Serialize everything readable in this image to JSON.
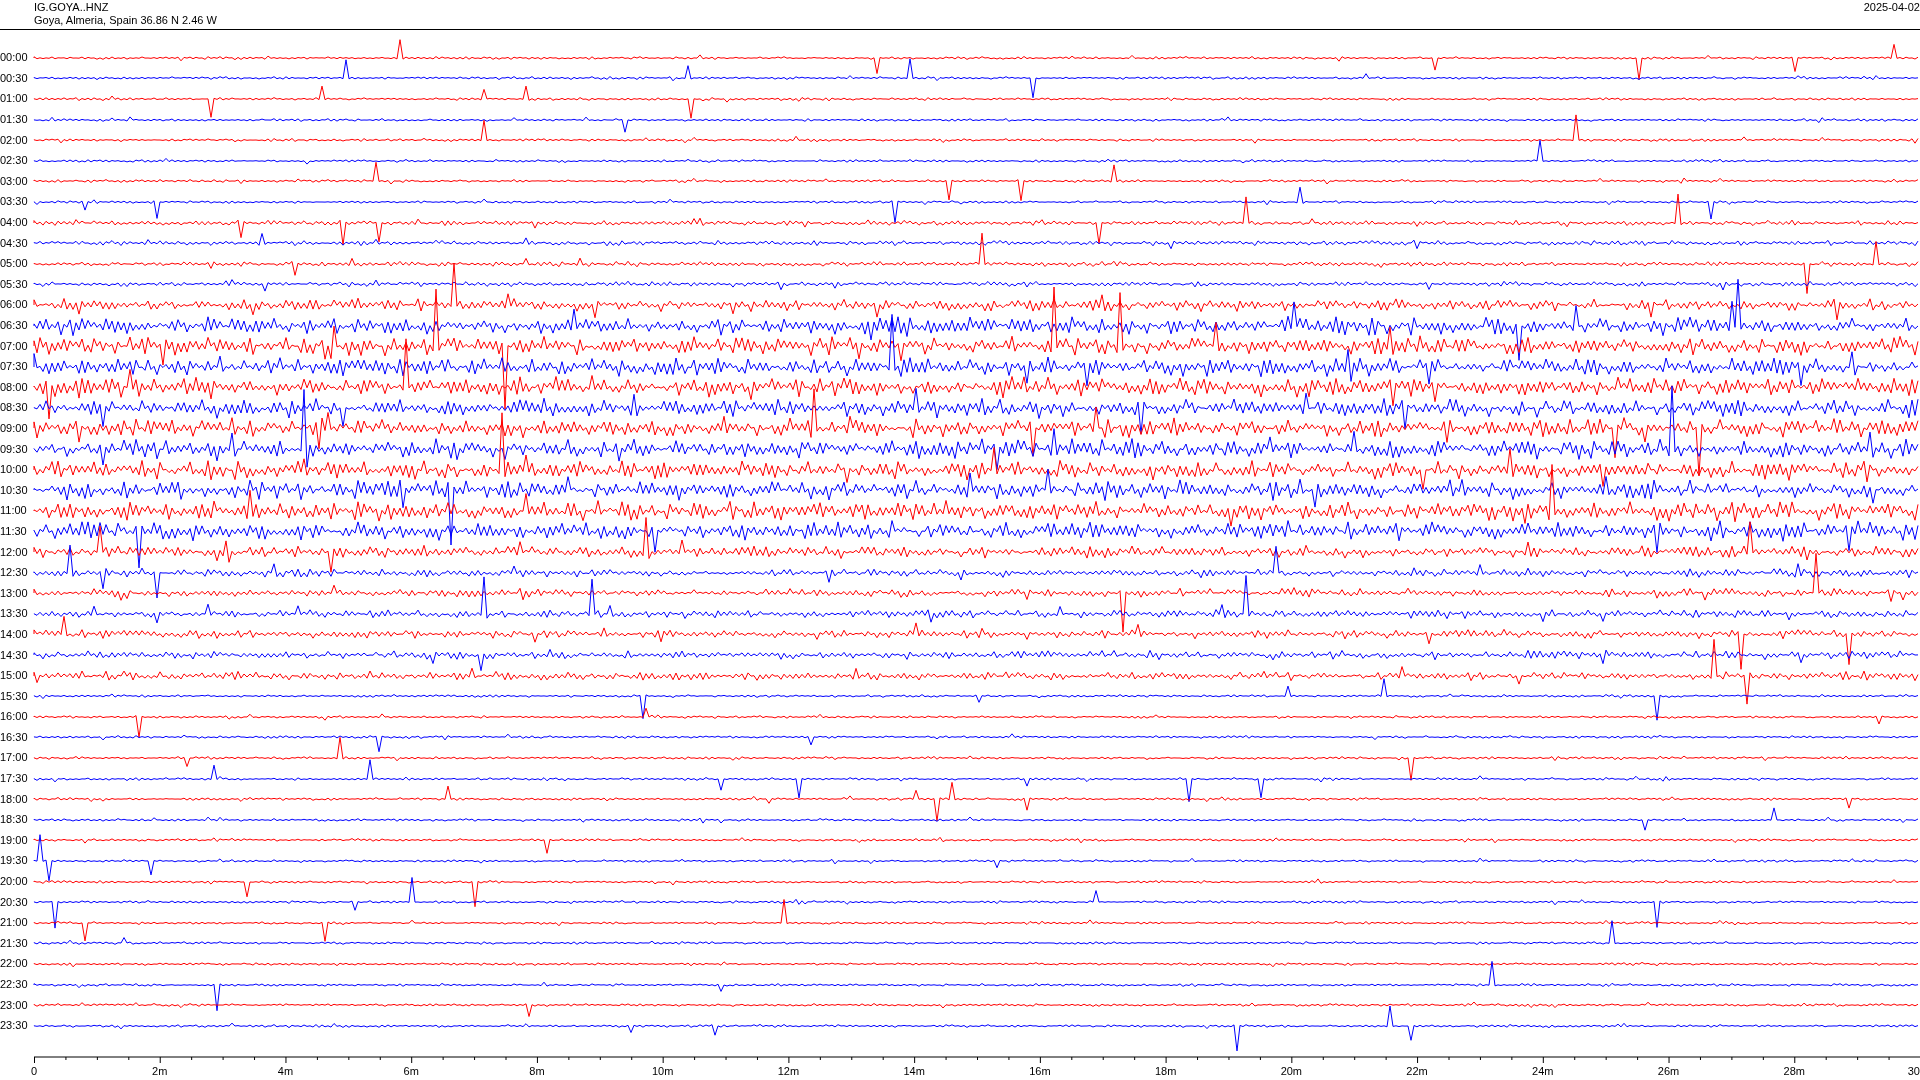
{
  "header": {
    "station": "IG.GOYA..HNZ",
    "location": "Goya, Almeria, Spain  36.86 N 2.46 W",
    "date": "2025-04-02"
  },
  "rows": [
    {
      "time": "00:00",
      "color": "#ff0000"
    },
    {
      "time": "00:30",
      "color": "#0000ff"
    },
    {
      "time": "01:00",
      "color": "#ff0000"
    },
    {
      "time": "01:30",
      "color": "#0000ff"
    },
    {
      "time": "02:00",
      "color": "#ff0000"
    },
    {
      "time": "02:30",
      "color": "#0000ff"
    },
    {
      "time": "03:00",
      "color": "#ff0000"
    },
    {
      "time": "03:30",
      "color": "#0000ff"
    },
    {
      "time": "04:00",
      "color": "#ff0000"
    },
    {
      "time": "04:30",
      "color": "#0000ff"
    },
    {
      "time": "05:00",
      "color": "#ff0000"
    },
    {
      "time": "05:30",
      "color": "#0000ff"
    },
    {
      "time": "06:00",
      "color": "#ff0000"
    },
    {
      "time": "06:30",
      "color": "#0000ff"
    },
    {
      "time": "07:00",
      "color": "#ff0000"
    },
    {
      "time": "07:30",
      "color": "#0000ff"
    },
    {
      "time": "08:00",
      "color": "#ff0000"
    },
    {
      "time": "08:30",
      "color": "#0000ff"
    },
    {
      "time": "09:00",
      "color": "#ff0000"
    },
    {
      "time": "09:30",
      "color": "#0000ff"
    },
    {
      "time": "10:00",
      "color": "#ff0000"
    },
    {
      "time": "10:30",
      "color": "#0000ff"
    },
    {
      "time": "11:00",
      "color": "#ff0000"
    },
    {
      "time": "11:30",
      "color": "#0000ff"
    },
    {
      "time": "12:00",
      "color": "#ff0000"
    },
    {
      "time": "12:30",
      "color": "#0000ff"
    },
    {
      "time": "13:00",
      "color": "#ff0000"
    },
    {
      "time": "13:30",
      "color": "#0000ff"
    },
    {
      "time": "14:00",
      "color": "#ff0000"
    },
    {
      "time": "14:30",
      "color": "#0000ff"
    },
    {
      "time": "15:00",
      "color": "#ff0000"
    },
    {
      "time": "15:30",
      "color": "#0000ff"
    },
    {
      "time": "16:00",
      "color": "#ff0000"
    },
    {
      "time": "16:30",
      "color": "#0000ff"
    },
    {
      "time": "17:00",
      "color": "#ff0000"
    },
    {
      "time": "17:30",
      "color": "#0000ff"
    },
    {
      "time": "18:00",
      "color": "#ff0000"
    },
    {
      "time": "18:30",
      "color": "#0000ff"
    },
    {
      "time": "19:00",
      "color": "#ff0000"
    },
    {
      "time": "19:30",
      "color": "#0000ff"
    },
    {
      "time": "20:00",
      "color": "#ff0000"
    },
    {
      "time": "20:30",
      "color": "#0000ff"
    },
    {
      "time": "21:00",
      "color": "#ff0000"
    },
    {
      "time": "21:30",
      "color": "#0000ff"
    },
    {
      "time": "22:00",
      "color": "#ff0000"
    },
    {
      "time": "22:30",
      "color": "#0000ff"
    },
    {
      "time": "23:00",
      "color": "#ff0000"
    },
    {
      "time": "23:30",
      "color": "#0000ff"
    }
  ],
  "axis": {
    "labels": [
      "0",
      "2m",
      "4m",
      "6m",
      "8m",
      "10m",
      "12m",
      "14m",
      "16m",
      "18m",
      "20m",
      "22m",
      "24m",
      "26m",
      "28m",
      "30"
    ]
  }
}
